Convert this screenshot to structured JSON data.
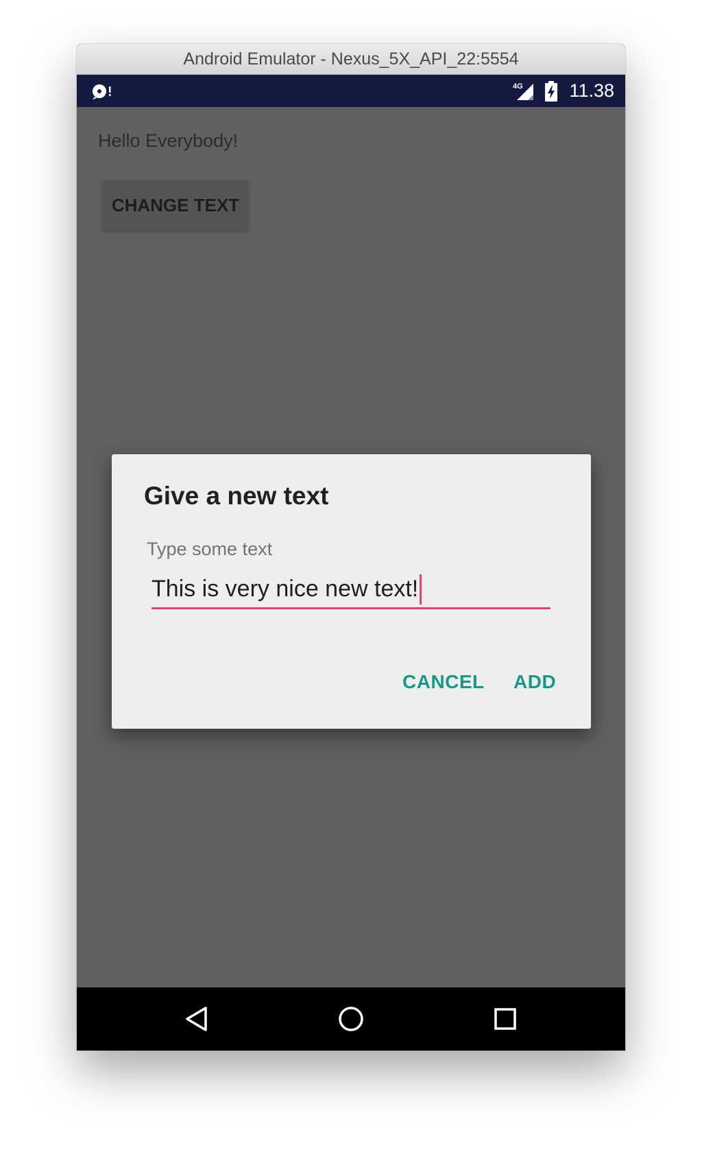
{
  "window": {
    "title": "Android Emulator - Nexus_5X_API_22:5554"
  },
  "statusbar": {
    "left_icon": "debug-icon",
    "network_label": "4G",
    "signal_icon": "signal-icon",
    "battery_icon": "battery-charging-icon",
    "time": "11.38"
  },
  "app": {
    "hello_text": "Hello Everybody!",
    "change_button_label": "CHANGE TEXT",
    "background_color": "#606060"
  },
  "dialog": {
    "title": "Give a new text",
    "field_label": "Type some text",
    "field_value": "This is very nice new text!",
    "cancel_label": "CANCEL",
    "add_label": "ADD",
    "accent_color": "#169a87",
    "underline_color": "#e8417a"
  },
  "navbar": {
    "back_icon": "back-icon",
    "home_icon": "home-icon",
    "recents_icon": "recents-icon"
  }
}
